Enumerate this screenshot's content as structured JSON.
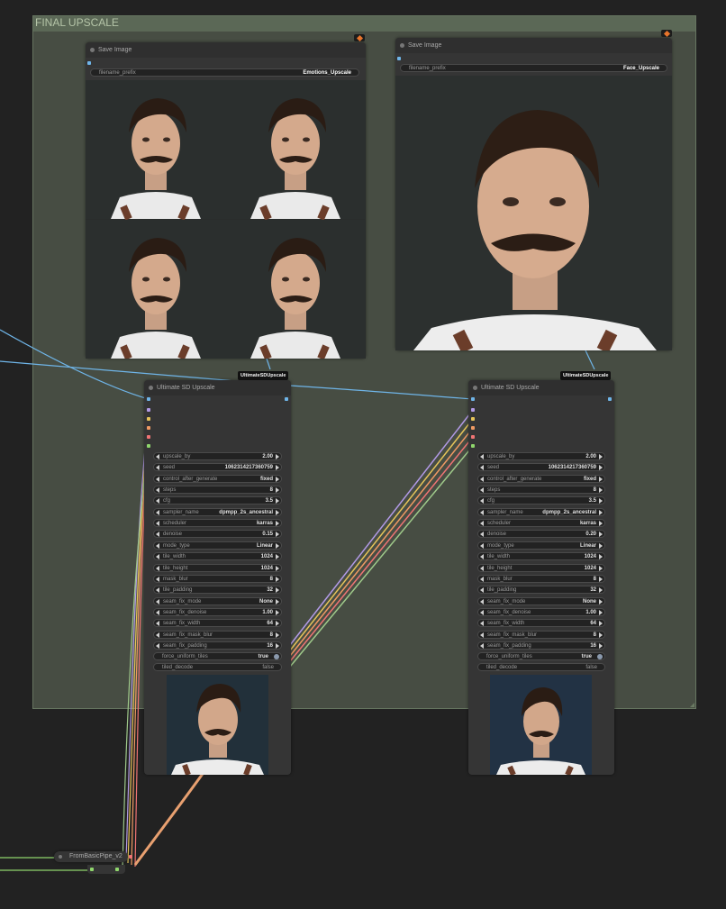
{
  "group": {
    "title": "FINAL UPSCALE"
  },
  "save_left": {
    "title": "Save Image",
    "filename_label": "filename_prefix",
    "filename_value": "Emotions_Upscale"
  },
  "save_right": {
    "title": "Save Image",
    "filename_label": "filename_prefix",
    "filename_value": "Face_Upscale"
  },
  "tags": {
    "left": "UltimateSDUpscale",
    "right": "UltimateSDUpscale"
  },
  "upscale_left": {
    "title": "Ultimate SD Upscale",
    "params": [
      {
        "name": "upscale_by",
        "value": "2.00"
      },
      {
        "name": "seed",
        "value": "1062314217360759"
      },
      {
        "name": "control_after_generate",
        "value": "fixed"
      },
      {
        "name": "steps",
        "value": "8"
      },
      {
        "name": "cfg",
        "value": "3.5"
      },
      {
        "name": "sampler_name",
        "value": "dpmpp_2s_ancestral"
      },
      {
        "name": "scheduler",
        "value": "karras"
      },
      {
        "name": "denoise",
        "value": "0.15"
      },
      {
        "name": "mode_type",
        "value": "Linear"
      },
      {
        "name": "tile_width",
        "value": "1024"
      },
      {
        "name": "tile_height",
        "value": "1024"
      },
      {
        "name": "mask_blur",
        "value": "8"
      },
      {
        "name": "tile_padding",
        "value": "32"
      },
      {
        "name": "seam_fix_mode",
        "value": "None"
      },
      {
        "name": "seam_fix_denoise",
        "value": "1.00"
      },
      {
        "name": "seam_fix_width",
        "value": "64"
      },
      {
        "name": "seam_fix_mask_blur",
        "value": "8"
      },
      {
        "name": "seam_fix_padding",
        "value": "16"
      }
    ],
    "force_uniform_tiles": {
      "name": "force_uniform_tiles",
      "value": "true"
    },
    "tiled_decode": {
      "name": "tiled_decode",
      "value": "false"
    }
  },
  "upscale_right": {
    "title": "Ultimate SD Upscale",
    "params": [
      {
        "name": "upscale_by",
        "value": "2.00"
      },
      {
        "name": "seed",
        "value": "1062314217360759"
      },
      {
        "name": "control_after_generate",
        "value": "fixed"
      },
      {
        "name": "steps",
        "value": "8"
      },
      {
        "name": "cfg",
        "value": "3.5"
      },
      {
        "name": "sampler_name",
        "value": "dpmpp_2s_ancestral"
      },
      {
        "name": "scheduler",
        "value": "karras"
      },
      {
        "name": "denoise",
        "value": "0.20"
      },
      {
        "name": "mode_type",
        "value": "Linear"
      },
      {
        "name": "tile_width",
        "value": "1024"
      },
      {
        "name": "tile_height",
        "value": "1024"
      },
      {
        "name": "mask_blur",
        "value": "8"
      },
      {
        "name": "tile_padding",
        "value": "32"
      },
      {
        "name": "seam_fix_mode",
        "value": "None"
      },
      {
        "name": "seam_fix_denoise",
        "value": "1.00"
      },
      {
        "name": "seam_fix_width",
        "value": "64"
      },
      {
        "name": "seam_fix_mask_blur",
        "value": "8"
      },
      {
        "name": "seam_fix_padding",
        "value": "16"
      }
    ],
    "force_uniform_tiles": {
      "name": "force_uniform_tiles",
      "value": "true"
    },
    "tiled_decode": {
      "name": "tiled_decode",
      "value": "false"
    }
  },
  "pipe_node": {
    "title": "FromBasicPipe_v2"
  },
  "colors": {
    "wire_blue": "#6fb5e8",
    "wire_purple": "#b29ae6",
    "wire_yellow": "#e6c45a",
    "wire_orange": "#f09a64",
    "wire_red": "#f07474",
    "wire_green": "#8fd66c",
    "group_bg": "#474d43",
    "node_bg": "#353535"
  },
  "icons": {
    "node_badge": "fox-icon",
    "output_image": "image-preview"
  }
}
